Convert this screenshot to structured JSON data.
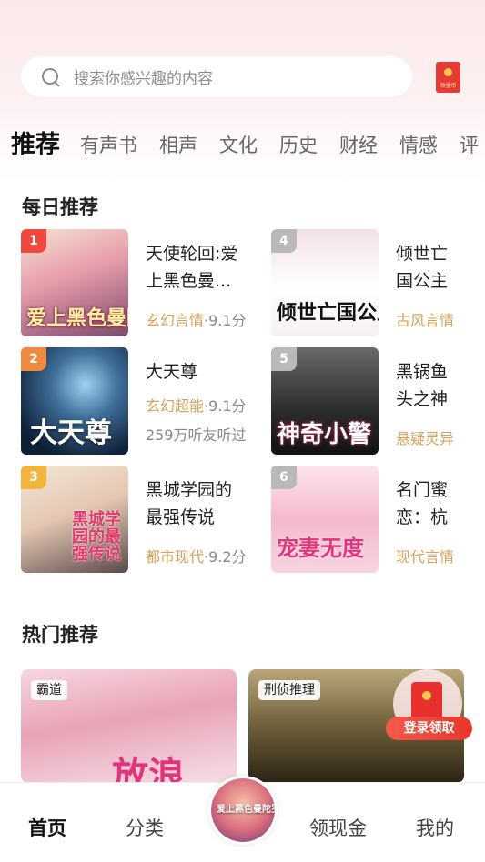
{
  "search": {
    "placeholder": "搜索你感兴趣的内容"
  },
  "header": {
    "redpacket_label": "领金币"
  },
  "tabs": [
    "推荐",
    "有声书",
    "相声",
    "文化",
    "历史",
    "财经",
    "情感",
    "评"
  ],
  "daily": {
    "title": "每日推荐",
    "items": [
      {
        "rank": "1",
        "cover_text": "爱上黑色曼陀罗",
        "title": "天使轮回:爱上黑色曼...",
        "category": "玄幻言情",
        "score": "·9.1分",
        "extra": ""
      },
      {
        "rank": "2",
        "cover_text": "大天尊",
        "title": "大天尊",
        "category": "玄幻超能",
        "score": "·9.1分",
        "extra": "259万听友听过"
      },
      {
        "rank": "3",
        "cover_text": "黑城学园的最强传说",
        "title": "黑城学园的最强传说",
        "category": "都市现代",
        "score": "·9.2分",
        "extra": ""
      },
      {
        "rank": "4",
        "cover_text": "倾世亡国公主",
        "title": "倾世亡国公主",
        "category": "古风言情",
        "score": "",
        "extra": ""
      },
      {
        "rank": "5",
        "cover_text": "神奇小警",
        "title": "黑锅鱼头之神奇小警",
        "category": "悬疑灵异",
        "score": "",
        "extra": ""
      },
      {
        "rank": "6",
        "cover_text": "宠妻无度",
        "title": "名门蜜恋：杭少，宠",
        "category": "现代言情",
        "score": "",
        "extra": ""
      }
    ],
    "badge_colors": [
      "#f0483e",
      "#f08a3e",
      "#f3b43a",
      "#b9b9b9",
      "#b9b9b9",
      "#b9b9b9"
    ]
  },
  "hot": {
    "title": "热门推荐",
    "cards": [
      {
        "tag": "霸道",
        "text": "放浪"
      },
      {
        "tag": "刑侦推理",
        "text": ""
      }
    ]
  },
  "floating": {
    "login_label": "登录领取"
  },
  "bottom_nav": {
    "items": [
      "首页",
      "分类",
      "领现金",
      "我的"
    ],
    "center_text": "爱上黑色曼陀罗"
  },
  "colors": {
    "accent": "#e8453c",
    "category": "#d6a15a"
  }
}
